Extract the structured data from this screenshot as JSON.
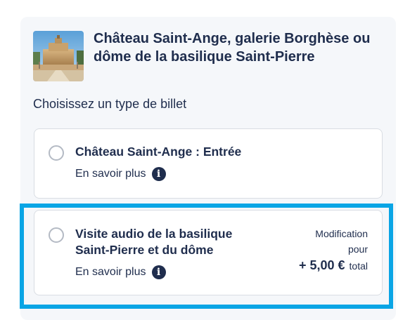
{
  "header": {
    "title": "Château Saint-Ange, galerie Borghèse ou dôme de la basilique Saint-Pierre",
    "image_subject": "Castel Sant'Angelo"
  },
  "ticket_section": {
    "label": "Choisissez un type de billet"
  },
  "options": [
    {
      "title": "Château Saint-Ange : Entrée",
      "more_label": "En savoir plus",
      "selected": false
    },
    {
      "title": "Visite audio de la basilique Saint-Pierre et du dôme",
      "more_label": "En savoir plus",
      "selected": false,
      "price_note": "Modification pour",
      "price_amount": "+ 5,00 €",
      "price_unit": "total",
      "highlighted": true
    }
  ],
  "colors": {
    "text": "#1f2d4d",
    "highlight": "#0aa5e5",
    "panel_bg": "#f5f7fa"
  },
  "icons": [
    "info-icon",
    "radio-unselected"
  ]
}
